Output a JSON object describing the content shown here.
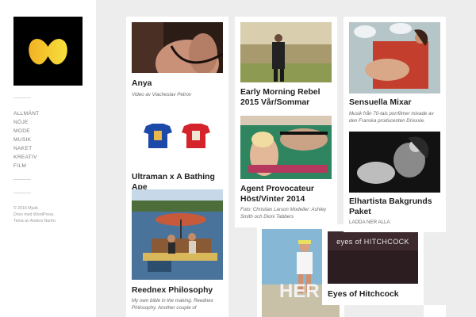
{
  "sidebar": {
    "logo": "site-logo",
    "nav": [
      "Allmänt",
      "Nöje",
      "Mode",
      "Musik",
      "Naket",
      "Kreativ",
      "Film"
    ],
    "footer": [
      "© 2016 Mjukt.",
      "Drivs med WordPress.",
      "Tema av Anders Norén."
    ]
  },
  "posts": {
    "anya": {
      "title": "Anya",
      "subtitle": "Video av Viacheslav Petrov"
    },
    "ultraman": {
      "title": "Ultraman x A Bathing Ape"
    },
    "redneck": {
      "title": "Reednex Philosophy",
      "subtitle": "My own bible in the making. Reednex Philosophy. Another couple of"
    },
    "early": {
      "title": "Early Morning Rebel 2015 Vår/Sommar"
    },
    "agent": {
      "title": "Agent Provocateur Höst/Vinter 2014",
      "subtitle": "Foto: Christian Larson Modeller: Ashley Smith och Dioni Tabbers"
    },
    "her": {
      "title": ""
    },
    "hitchcock": {
      "title": "Eyes of Hitchcock",
      "image_text": "eyes of HITCHCOCK"
    },
    "sensuella": {
      "title": "Sensuella Mixar",
      "subtitle": "Musik från 70-tals porrfilmer mixade av den Franska producenten Drixxxie."
    },
    "elhartista": {
      "title": "Elhartista Bakgrunds Paket",
      "subtitle": "LADDA NER ALLA"
    }
  },
  "colors": {
    "background": "#ededed",
    "card": "#ffffff",
    "nav_text": "#7a7a7a"
  }
}
